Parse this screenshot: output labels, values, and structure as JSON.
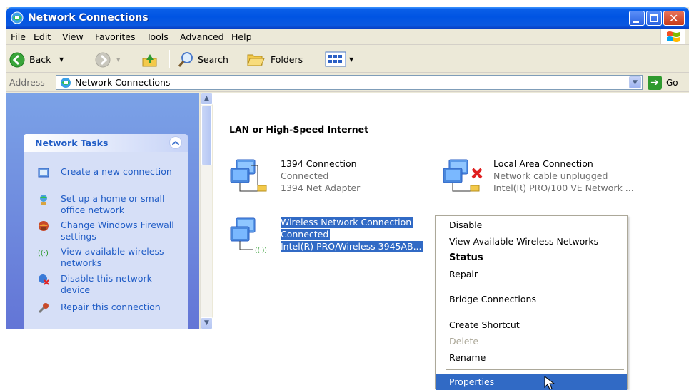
{
  "window": {
    "title": "Network Connections"
  },
  "menubar": {
    "items": [
      "File",
      "Edit",
      "View",
      "Favorites",
      "Tools",
      "Advanced",
      "Help"
    ]
  },
  "toolbar": {
    "back_label": "Back",
    "search_label": "Search",
    "folders_label": "Folders"
  },
  "addressbar": {
    "label": "Address",
    "value": "Network Connections",
    "go_label": "Go"
  },
  "left_pane": {
    "panel_title": "Network Tasks",
    "tasks": [
      {
        "label": "Create a new connection",
        "icon": "new-connection-icon"
      },
      {
        "label": "Set up a home or small office network",
        "icon": "home-network-icon"
      },
      {
        "label": "Change Windows Firewall settings",
        "icon": "firewall-icon"
      },
      {
        "label": "View available wireless networks",
        "icon": "wireless-icon"
      },
      {
        "label": "Disable this network device",
        "icon": "disable-network-icon"
      },
      {
        "label": "Repair this connection",
        "icon": "repair-icon"
      }
    ]
  },
  "content": {
    "group_header": "LAN or High-Speed Internet",
    "connections": [
      {
        "name": "1394 Connection",
        "status": "Connected",
        "device": "1394 Net Adapter"
      },
      {
        "name": "Local Area Connection",
        "status": "Network cable unplugged",
        "device": "Intel(R) PRO/100 VE Network ..."
      },
      {
        "name": "Wireless Network Connection",
        "status": "Connected",
        "device": "Intel(R) PRO/Wireless 3945AB..."
      }
    ]
  },
  "context_menu": {
    "items": [
      {
        "label": "Disable",
        "state": "normal"
      },
      {
        "label": "View Available Wireless Networks",
        "state": "normal"
      },
      {
        "label": "Status",
        "state": "default"
      },
      {
        "label": "Repair",
        "state": "normal"
      },
      {
        "label": "Bridge Connections",
        "state": "normal"
      },
      {
        "label": "Create Shortcut",
        "state": "normal"
      },
      {
        "label": "Delete",
        "state": "disabled"
      },
      {
        "label": "Rename",
        "state": "normal"
      },
      {
        "label": "Properties",
        "state": "highlighted"
      }
    ]
  },
  "colors": {
    "titlebar": "#0054e3",
    "selection": "#316ac5",
    "task_link": "#215dc6",
    "error_x": "#e02020"
  }
}
